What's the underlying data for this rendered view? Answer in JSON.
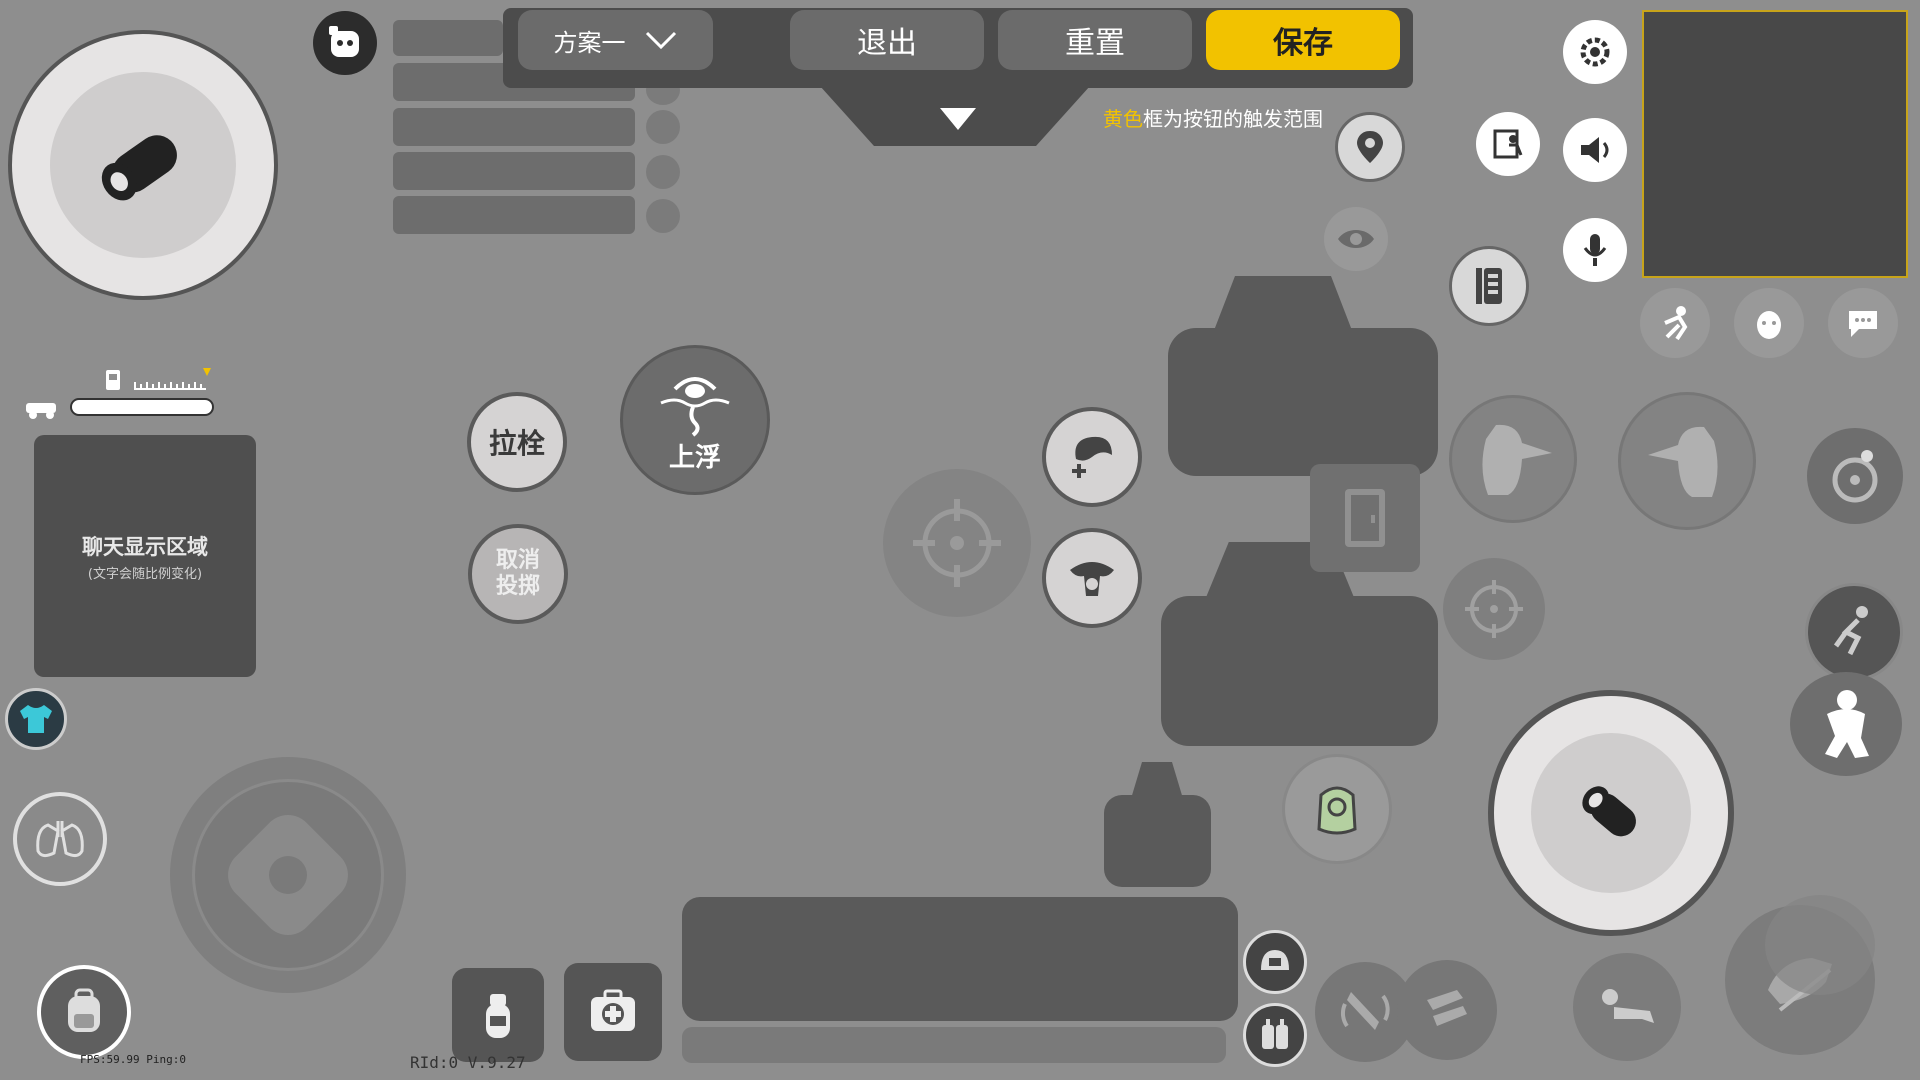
{
  "top_bar": {
    "scheme_label": "方案一",
    "exit_label": "退出",
    "reset_label": "重置",
    "save_label": "保存",
    "save_color": "#f2c200"
  },
  "hint": {
    "highlight": "黄色",
    "rest": "框为按钮的触发范围"
  },
  "chat_area": {
    "title": "聊天显示区域",
    "subtitle": "(文字会随比例变化)"
  },
  "buttons": {
    "pull_bolt": "拉栓",
    "float_up": "上浮",
    "cancel_throw": "取消投掷"
  },
  "status": {
    "fps_ping": "FPS:59.99 Ping:0",
    "version": "RId:0 V.9.27"
  },
  "icons": [
    "settings-gear-icon",
    "location-pin-icon",
    "eye-icon",
    "exit-vehicle-icon",
    "speaker-icon",
    "microphone-icon",
    "emote-icon",
    "sticker-icon",
    "chat-bubble-icon",
    "fuel-icon",
    "vehicle-icon",
    "shirt-icon",
    "lungs-icon",
    "backpack-icon",
    "grenade-icon",
    "medkit-icon",
    "helmet-icon",
    "armor-icon",
    "crosshair-icon",
    "door-icon",
    "bullet-fire-icon"
  ]
}
